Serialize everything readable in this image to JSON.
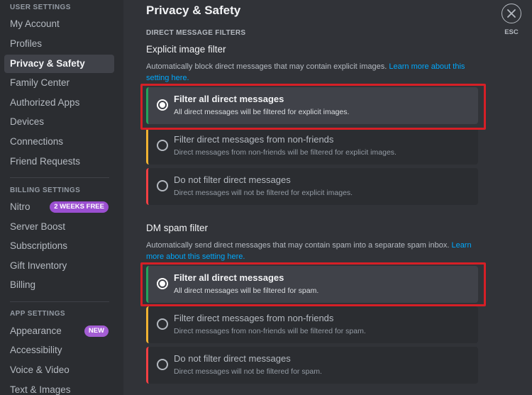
{
  "sidebar": {
    "user_settings_header": "User Settings",
    "user_items": [
      {
        "label": "My Account"
      },
      {
        "label": "Profiles"
      },
      {
        "label": "Privacy & Safety"
      },
      {
        "label": "Family Center"
      },
      {
        "label": "Authorized Apps"
      },
      {
        "label": "Devices"
      },
      {
        "label": "Connections"
      },
      {
        "label": "Friend Requests"
      }
    ],
    "billing_settings_header": "Billing Settings",
    "billing_items": [
      {
        "label": "Nitro",
        "badge": "2 Weeks Free"
      },
      {
        "label": "Server Boost"
      },
      {
        "label": "Subscriptions"
      },
      {
        "label": "Gift Inventory"
      },
      {
        "label": "Billing"
      }
    ],
    "app_settings_header": "App Settings",
    "app_items": [
      {
        "label": "Appearance",
        "badge": "New"
      },
      {
        "label": "Accessibility"
      },
      {
        "label": "Voice & Video"
      },
      {
        "label": "Text & Images"
      }
    ],
    "active_item": "Privacy & Safety"
  },
  "main": {
    "page_title": "Privacy & Safety",
    "close_label": "ESC",
    "dm_filters_header": "Direct Message Filters",
    "explicit": {
      "title": "Explicit image filter",
      "description": "Automatically block direct messages that may contain explicit images.",
      "link": "Learn more about this setting here.",
      "options": [
        {
          "title": "Filter all direct messages",
          "description": "All direct messages will be filtered for explicit images.",
          "selected": true,
          "accent": "green"
        },
        {
          "title": "Filter direct messages from non-friends",
          "description": "Direct messages from non-friends will be filtered for explicit images.",
          "selected": false,
          "accent": "yellow"
        },
        {
          "title": "Do not filter direct messages",
          "description": "Direct messages will not be filtered for explicit images.",
          "selected": false,
          "accent": "red"
        }
      ]
    },
    "spam": {
      "title": "DM spam filter",
      "description": "Automatically send direct messages that may contain spam into a separate spam inbox.",
      "link": "Learn more about this setting here.",
      "options": [
        {
          "title": "Filter all direct messages",
          "description": "All direct messages will be filtered for spam.",
          "selected": true,
          "accent": "green"
        },
        {
          "title": "Filter direct messages from non-friends",
          "description": "Direct messages from non-friends will be filtered for spam.",
          "selected": false,
          "accent": "yellow"
        },
        {
          "title": "Do not filter direct messages",
          "description": "Direct messages will not be filtered for spam.",
          "selected": false,
          "accent": "red"
        }
      ]
    }
  },
  "colors": {
    "background": "#313338",
    "sidebar": "#2b2d31",
    "link": "#00a8fc",
    "highlight_box": "#d61f26",
    "accent_green": "#23a55a",
    "accent_yellow": "#f0b232",
    "accent_red": "#f23f43"
  }
}
